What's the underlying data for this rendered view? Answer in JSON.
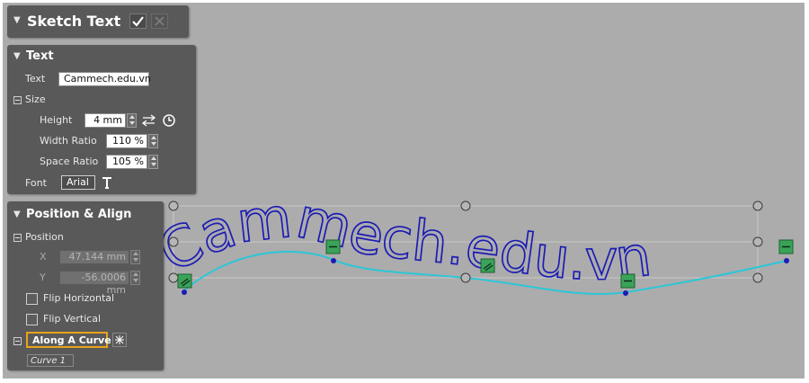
{
  "dialog": {
    "title": "Sketch Text",
    "ok_icon": "checkmark-icon",
    "cancel_icon": "close-icon",
    "pin_icon": "pin-icon"
  },
  "text_section": {
    "title": "Text",
    "text_label": "Text",
    "text_value": "Cammech.edu.vn",
    "size_label": "Size",
    "height_label": "Height",
    "height_value": "4 mm",
    "width_ratio_label": "Width Ratio",
    "width_ratio_value": "110 %",
    "space_ratio_label": "Space Ratio",
    "space_ratio_value": "105 %",
    "font_label": "Font",
    "font_value": "Arial"
  },
  "position_section": {
    "title": "Position & Align",
    "position_label": "Position",
    "x_label": "X",
    "x_value": "47.144 mm",
    "y_label": "Y",
    "y_value": "-56.0006 mm",
    "flip_horizontal_label": "Flip Horizontal",
    "flip_horizontal_checked": false,
    "flip_vertical_label": "Flip Vertical",
    "flip_vertical_checked": false,
    "along_curve_label": "Along A Curve",
    "curve_value": "Curve 1"
  },
  "viewport": {
    "sketch_text": "Cammech.edu.vn",
    "text_color": "#1b1bb4",
    "curve_color": "#2cc6d8",
    "handle_color": "#3aa35a"
  }
}
